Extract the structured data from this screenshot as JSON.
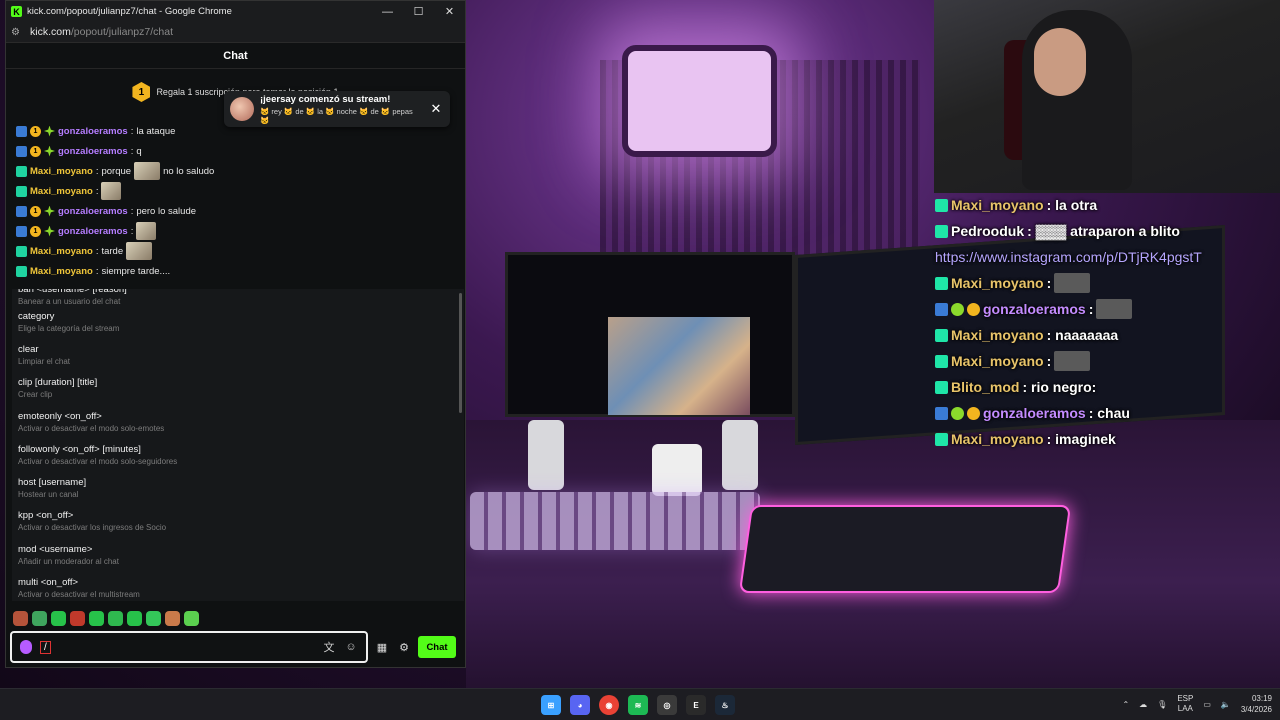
{
  "window": {
    "title": "kick.com/popout/julianpz7/chat - Google Chrome",
    "logo_letter": "K",
    "minimize": "—",
    "maximize": "☐",
    "close": "✕",
    "address_host": "kick.com",
    "address_path": "/popout/julianpz7/chat"
  },
  "chat": {
    "header": "Chat",
    "pinned": {
      "badge": "1",
      "text": "Regala 1 suscripción para tomar la posición 1"
    },
    "toast": {
      "title": "¡jeersay comenzó su stream!",
      "subtitle": "🐱 rey 🐱 de 🐱 la 🐱 noche 🐱 de 🐱 pepas 🐱",
      "close": "✕"
    },
    "messages": [
      {
        "user": "gonzaloeramos",
        "text": "la ataque",
        "color": "purple",
        "badges": [
          "vip",
          "gift",
          "og"
        ],
        "emote": false
      },
      {
        "user": "gonzaloeramos",
        "text": "q",
        "color": "purple",
        "badges": [
          "vip",
          "gift",
          "og"
        ],
        "emote": false
      },
      {
        "user": "Maxi_moyano",
        "text": "porque",
        "text2": "no lo saludo",
        "color": "gold",
        "badges": [
          "sub"
        ],
        "emote": true
      },
      {
        "user": "Maxi_moyano",
        "text": "",
        "color": "gold",
        "badges": [
          "sub"
        ],
        "emote": true
      },
      {
        "user": "gonzaloeramos",
        "text": "pero lo salude",
        "color": "purple",
        "badges": [
          "vip",
          "gift",
          "og"
        ],
        "emote": false
      },
      {
        "user": "gonzaloeramos",
        "text": "",
        "color": "purple",
        "badges": [
          "vip",
          "gift",
          "og"
        ],
        "emote": true
      },
      {
        "user": "Maxi_moyano",
        "text": "tarde",
        "color": "gold",
        "badges": [
          "sub"
        ],
        "emote": true
      },
      {
        "user": "Maxi_moyano",
        "text": "siempre tarde....",
        "color": "gold",
        "badges": [
          "sub"
        ],
        "emote": false
      }
    ],
    "commands": [
      {
        "name": "ban <username> [reason]",
        "desc": "Banear a un usuario del chat"
      },
      {
        "name": "category",
        "desc": "Elige la categoría del stream"
      },
      {
        "name": "clear",
        "desc": "Limpiar el chat"
      },
      {
        "name": "clip [duration] [title]",
        "desc": "Crear clip"
      },
      {
        "name": "emoteonly <on_off>",
        "desc": "Activar o desactivar el modo solo-emotes"
      },
      {
        "name": "followonly <on_off> [minutes]",
        "desc": "Activar o desactivar el modo solo-seguidores"
      },
      {
        "name": "host [username]",
        "desc": "Hostear un canal"
      },
      {
        "name": "kpp <on_off>",
        "desc": "Activar o desactivar los ingresos de Socio"
      },
      {
        "name": "mod <username>",
        "desc": "Añadir un moderador al chat"
      },
      {
        "name": "multi <on_off>",
        "desc": "Activar o desactivar el multistream"
      }
    ],
    "input_value": "/",
    "send_label": "Chat"
  },
  "overlay_chat": [
    {
      "user": "Maxi_moyano",
      "text": ": la otra",
      "color": "gold",
      "badges": [
        "sub"
      ]
    },
    {
      "user": "Pedrooduk",
      "text": ": ▓▓▓  atraparon a blito",
      "color": "white",
      "badges": [
        "sub"
      ]
    },
    {
      "user": "",
      "text": "https://www.instagram.com/p/DTjRK4pgstT",
      "color": "link",
      "badges": []
    },
    {
      "user": "Maxi_moyano",
      "text": ":",
      "color": "gold",
      "badges": [
        "sub"
      ],
      "thumb": true
    },
    {
      "user": "gonzaloeramos",
      "text": ":",
      "color": "purple",
      "badges": [
        "vip",
        "og",
        "gift"
      ],
      "thumb": true
    },
    {
      "user": "Maxi_moyano",
      "text": ": naaaaaaa",
      "color": "gold",
      "badges": [
        "sub"
      ]
    },
    {
      "user": "Maxi_moyano",
      "text": ":",
      "color": "gold",
      "badges": [
        "sub"
      ],
      "thumb": true
    },
    {
      "user": "Blito_mod",
      "text": ": rio negro:",
      "color": "gold",
      "badges": [
        "sub"
      ]
    },
    {
      "user": "gonzaloeramos",
      "text": ": chau",
      "color": "purple",
      "badges": [
        "vip",
        "og",
        "gift"
      ]
    },
    {
      "user": "Maxi_moyano",
      "text": ": imaginek",
      "color": "gold",
      "badges": [
        "sub"
      ]
    }
  ],
  "taskbar": {
    "apps": [
      "windows-start",
      "discord",
      "chrome",
      "spotify",
      "obs",
      "epic-games",
      "steam"
    ],
    "lang_top": "ESP",
    "lang_bottom": "LAA",
    "time": "03:19",
    "date": "3/4/2026"
  }
}
